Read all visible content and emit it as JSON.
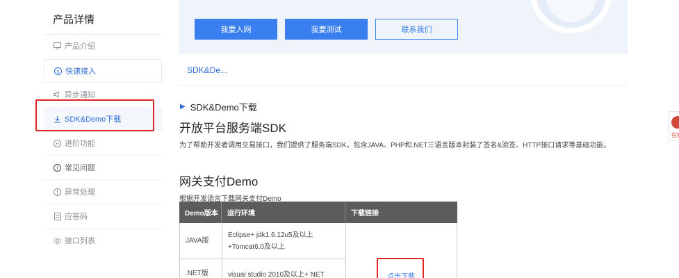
{
  "sidebar": {
    "title": "产品详情",
    "items": [
      {
        "label": "产品介绍",
        "icon": "monitor-icon"
      },
      {
        "label": "快速接入",
        "icon": "dollar-circle-icon"
      },
      {
        "label": "异步通知",
        "icon": "speaker-icon"
      },
      {
        "label": "SDK&Demo下载",
        "icon": "download-icon"
      },
      {
        "label": "进阶功能",
        "icon": "shield-icon"
      },
      {
        "label": "常见问题",
        "icon": "question-circle-icon"
      },
      {
        "label": "异常处理",
        "icon": "alert-circle-icon"
      },
      {
        "label": "应答码",
        "icon": "document-icon"
      },
      {
        "label": "接口列表",
        "icon": "gear-icon"
      }
    ]
  },
  "banner": {
    "buttons": [
      "我要入网",
      "我要测试",
      "联系我们"
    ]
  },
  "tabs": {
    "active": "SDK&De..."
  },
  "content": {
    "section_heading": "SDK&Demo下载",
    "server_title": "开放平台服务端SDK",
    "server_desc": "为了帮助开发者调用交易接口，我们提供了服务端SDK，包含JAVA、PHP和.NET三语言版本封装了签名&验签、HTTP接口请求等基础功能。",
    "gateway_title": "网关支付Demo",
    "gateway_desc": "根据开发语言下载网关支付Demo",
    "table": {
      "headers": [
        "Demo版本",
        "运行环境",
        "下载链接"
      ],
      "rows": [
        {
          "version": "JAVA版",
          "env_line1": "Eclipse+ jdk1.6.12u5及以上",
          "env_line2": "+Tomcat6.0及以上"
        },
        {
          "version": ".NET版",
          "env_line1": "visual studio  2010及以上+ NET",
          "env_line2": ""
        }
      ],
      "download_link": "点击下载"
    }
  },
  "float_widget": {
    "label": "在线"
  },
  "colors": {
    "accent": "#3a7ff0",
    "highlight_box": "#e02424",
    "table_header": "#5c5c5c"
  }
}
